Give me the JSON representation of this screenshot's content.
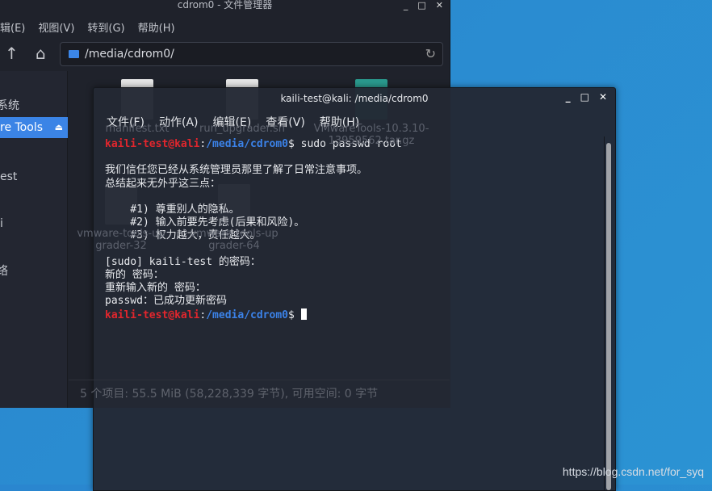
{
  "file_manager": {
    "title": "cdrom0 - 文件管理器",
    "menu": [
      "辑(E)",
      "视图(V)",
      "转到(G)",
      "帮助(H)"
    ],
    "address": "/media/cdrom0/",
    "sidebar": [
      "系统",
      "re Tools",
      "est",
      "i",
      "络"
    ],
    "files": [
      "manifest.txt",
      "run_upgrader.sh",
      "VMwareTools-10.3.10-13959562.tar.gz",
      "vmware-tools-upgrader-32",
      "vmware-tools-upgrader-64"
    ],
    "status": "5 个项目: 55.5 MiB (58,228,339 字节), 可用空间: 0 字节",
    "window_buttons": [
      "_",
      "□",
      "✕"
    ]
  },
  "terminal": {
    "title": "kaili-test@kali: /media/cdrom0",
    "menu": [
      "文件(F)",
      "动作(A)",
      "编辑(E)",
      "查看(V)",
      "帮助(H)"
    ],
    "user_host": "kaili-test@kali",
    "colon": ":",
    "path": "/media/cdrom0",
    "dollar": "$ ",
    "command": "sudo passwd root",
    "lines": [
      "我们信任您已经从系统管理员那里了解了日常注意事项。",
      "总结起来无外乎这三点：",
      "",
      "    #1) 尊重别人的隐私。",
      "    #2) 输入前要先考虑(后果和风险)。",
      "    #3) 权力越大，责任越大。",
      "",
      "[sudo] kaili-test 的密码：",
      "新的 密码：",
      "重新输入新的 密码：",
      "passwd：已成功更新密码"
    ],
    "window_buttons": [
      "_",
      "□",
      "✕"
    ]
  },
  "watermark": "https://blog.csdn.net/for_syq"
}
